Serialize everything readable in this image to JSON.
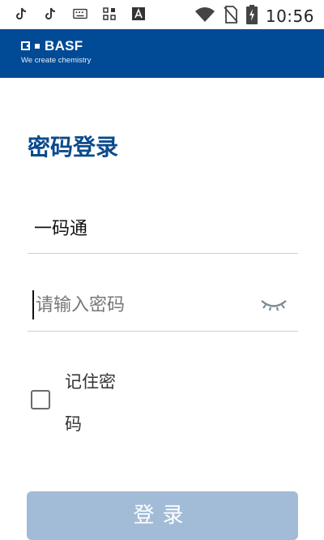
{
  "status_bar": {
    "icons": [
      "tiktok-icon",
      "tiktok-icon",
      "keyboard-icon",
      "apps-icon",
      "a-notification-icon",
      "wifi-icon",
      "no-sim-icon",
      "battery-charging-icon"
    ],
    "time": "10:56"
  },
  "brand": {
    "logo_text": "BASF",
    "tagline": "We create chemistry"
  },
  "login": {
    "title": "密码登录",
    "username_value": "一码通",
    "password_placeholder": "请输入密码",
    "remember_label": "记住密码",
    "remember_checked": false,
    "submit_label": "登录"
  },
  "colors": {
    "brand_blue": "#004a96",
    "title_blue": "#0a4a8c",
    "button_disabled": "#a2bcd8"
  }
}
